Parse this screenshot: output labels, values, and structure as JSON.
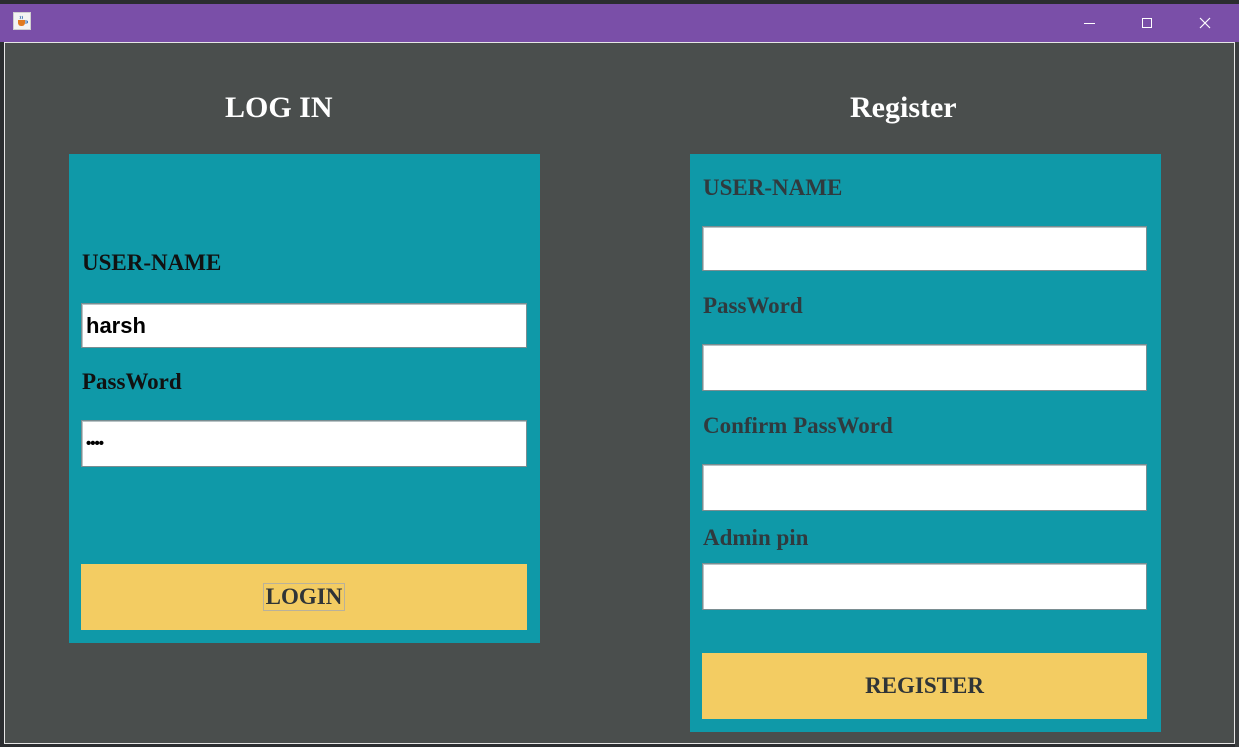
{
  "window": {
    "title_bar": {
      "app_icon": "java-cup-icon",
      "controls": [
        "minimize-icon",
        "maximize-icon",
        "close-icon"
      ],
      "accent_color": "#7a4fa8"
    },
    "background_color": "#4a4e4d"
  },
  "login": {
    "heading": "LOG IN",
    "username_label": "USER-NAME",
    "username_value": "harsh",
    "password_label": "PassWord",
    "password_value": "••••",
    "button_label": "LOGIN"
  },
  "register": {
    "heading": "Register",
    "username_label": "USER-NAME",
    "username_value": "",
    "password_label": "PassWord",
    "password_value": "",
    "confirm_password_label": "Confirm PassWord",
    "confirm_password_value": "",
    "admin_pin_label": "Admin pin",
    "admin_pin_value": "",
    "button_label": "REGISTER"
  },
  "colors": {
    "panel": "#0f99a8",
    "button": "#f3cc62"
  }
}
